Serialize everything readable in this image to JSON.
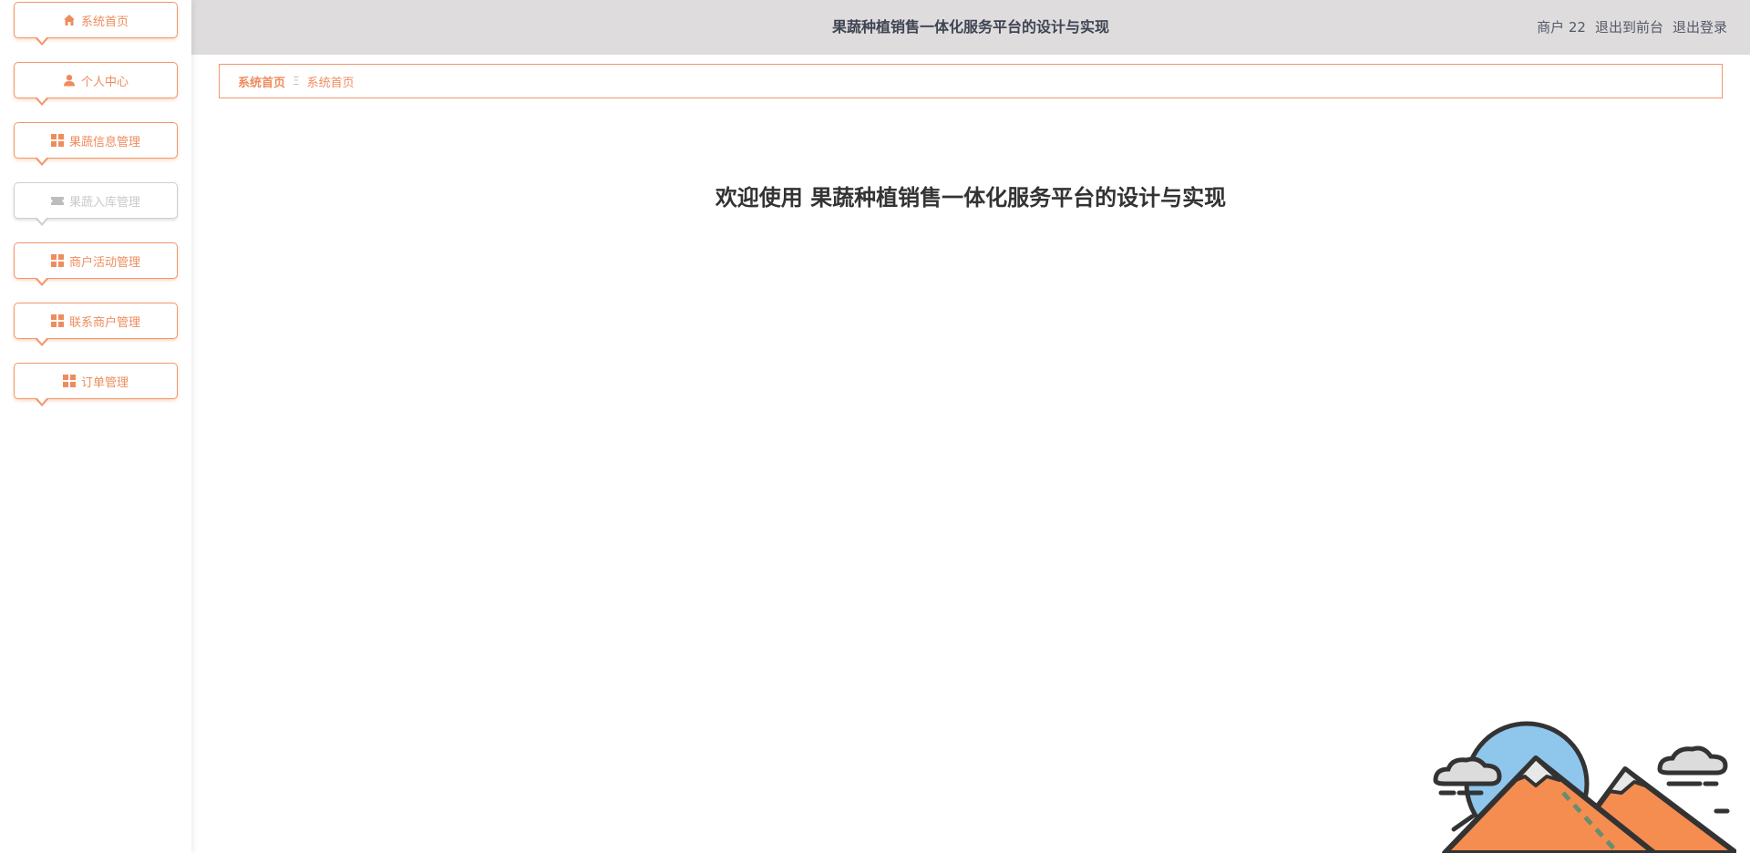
{
  "header": {
    "title": "果蔬种植销售一体化服务平台的设计与实现",
    "user_label": "商户 22",
    "to_front_label": "退出到前台",
    "logout_label": "退出登录"
  },
  "sidebar": {
    "items": [
      {
        "label": "系统首页",
        "icon": "home-icon"
      },
      {
        "label": "个人中心",
        "icon": "user-icon"
      },
      {
        "label": "果蔬信息管理",
        "icon": "grid-icon"
      },
      {
        "label": "果蔬入库管理",
        "icon": "ticket-icon"
      },
      {
        "label": "商户活动管理",
        "icon": "grid-icon"
      },
      {
        "label": "联系商户管理",
        "icon": "grid-icon"
      },
      {
        "label": "订单管理",
        "icon": "grid-icon"
      }
    ]
  },
  "breadcrumb": {
    "home": "系统首页",
    "separator": "Ξ",
    "current": "系统首页"
  },
  "main": {
    "welcome": "欢迎使用 果蔬种植销售一体化服务平台的设计与实现"
  },
  "colors": {
    "accent": "#ef8c5d",
    "header_bg": "#dedcdd",
    "inactive": "#cfcfcf"
  }
}
